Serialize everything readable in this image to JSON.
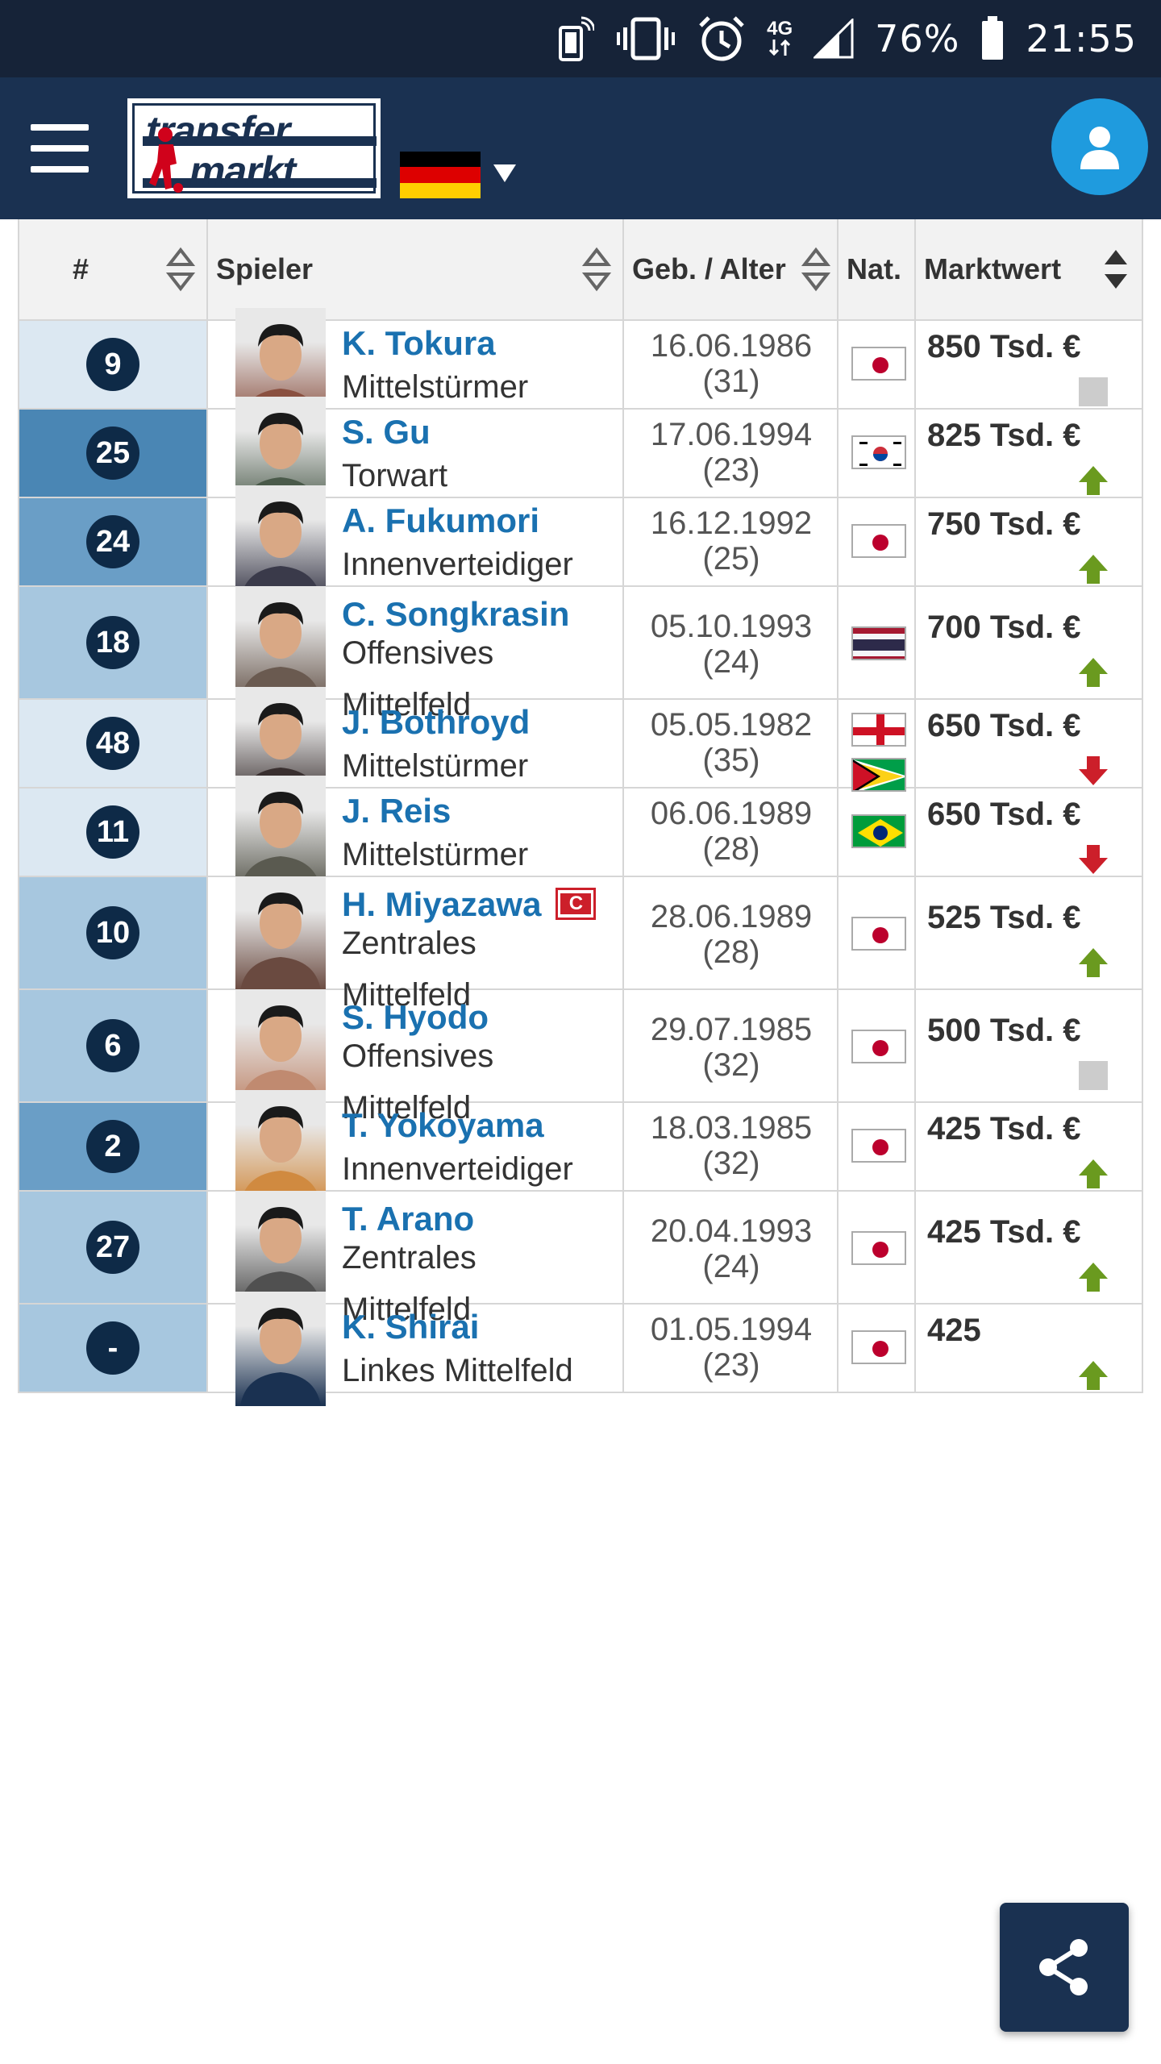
{
  "status_bar": {
    "battery_percent": "76%",
    "time": "21:55",
    "network": "4G"
  },
  "header": {
    "logo_line1": "transfer",
    "logo_line2": "markt",
    "country_flag_colors": [
      "#000000",
      "#dd0000",
      "#ffce00"
    ],
    "accent": "#1f9bde",
    "bar_color": "#1a3151"
  },
  "table": {
    "headers": {
      "number": "#",
      "player": "Spieler",
      "born_age": "Geb. / Alter",
      "nat": "Nat.",
      "market_value": "Marktwert"
    },
    "rows": [
      {
        "number": "9",
        "name": "K. Tokura",
        "position_line1": "Mittelstürmer",
        "position_line2": "",
        "born": "16.06.1986",
        "age": "(31)",
        "flags": [
          "japan"
        ],
        "value": "850 Tsd. €",
        "trend": "unchanged"
      },
      {
        "number": "25",
        "name": "S. Gu",
        "position_line1": "Torwart",
        "position_line2": "",
        "born": "17.06.1994",
        "age": "(23)",
        "flags": [
          "korea"
        ],
        "value": "825 Tsd. €",
        "trend": "up"
      },
      {
        "number": "24",
        "name": "A. Fukumori",
        "position_line1": "Innenverteidiger",
        "position_line2": "",
        "born": "16.12.1992",
        "age": "(25)",
        "flags": [
          "japan"
        ],
        "value": "750 Tsd. €",
        "trend": "up"
      },
      {
        "number": "18",
        "name": "C. Songkrasin",
        "position_line1": "Offensives",
        "position_line2": "Mittelfeld",
        "born": "05.10.1993",
        "age": "(24)",
        "flags": [
          "thailand"
        ],
        "value": "700 Tsd. €",
        "trend": "up"
      },
      {
        "number": "48",
        "name": "J. Bothroyd",
        "position_line1": "Mittelstürmer",
        "position_line2": "",
        "born": "05.05.1982",
        "age": "(35)",
        "flags": [
          "england",
          "guyana"
        ],
        "value": "650 Tsd. €",
        "trend": "down"
      },
      {
        "number": "11",
        "name": "J. Reis",
        "position_line1": "Mittelstürmer",
        "position_line2": "",
        "born": "06.06.1989",
        "age": "(28)",
        "flags": [
          "brazil"
        ],
        "value": "650 Tsd. €",
        "trend": "down"
      },
      {
        "number": "10",
        "name": "H. Miyazawa",
        "captain_badge": "C",
        "position_line1": "Zentrales",
        "position_line2": "Mittelfeld",
        "born": "28.06.1989",
        "age": "(28)",
        "flags": [
          "japan"
        ],
        "value": "525 Tsd. €",
        "trend": "up"
      },
      {
        "number": "6",
        "name": "S. Hyodo",
        "position_line1": "Offensives",
        "position_line2": "Mittelfeld",
        "born": "29.07.1985",
        "age": "(32)",
        "flags": [
          "japan"
        ],
        "value": "500 Tsd. €",
        "trend": "unchanged"
      },
      {
        "number": "2",
        "name": "T. Yokoyama",
        "position_line1": "Innenverteidiger",
        "position_line2": "",
        "born": "18.03.1985",
        "age": "(32)",
        "flags": [
          "japan"
        ],
        "value": "425 Tsd. €",
        "trend": "up"
      },
      {
        "number": "27",
        "name": "T. Arano",
        "position_line1": "Zentrales",
        "position_line2": "Mittelfeld",
        "born": "20.04.1993",
        "age": "(24)",
        "flags": [
          "japan"
        ],
        "value": "425 Tsd. €",
        "trend": "up"
      },
      {
        "number": "-",
        "name": "K. Shirai",
        "position_line1": "Linkes Mittelfeld",
        "position_line2": "",
        "born": "01.05.1994",
        "age": "(23)",
        "flags": [
          "japan"
        ],
        "value": "425",
        "trend": "up"
      }
    ]
  },
  "colors": {
    "trend_up": "#6a9a1f",
    "trend_down": "#cc1f2a",
    "trend_unchanged": "#cccccc",
    "name_link": "#1a71b0",
    "badge": "#0e2a47"
  }
}
